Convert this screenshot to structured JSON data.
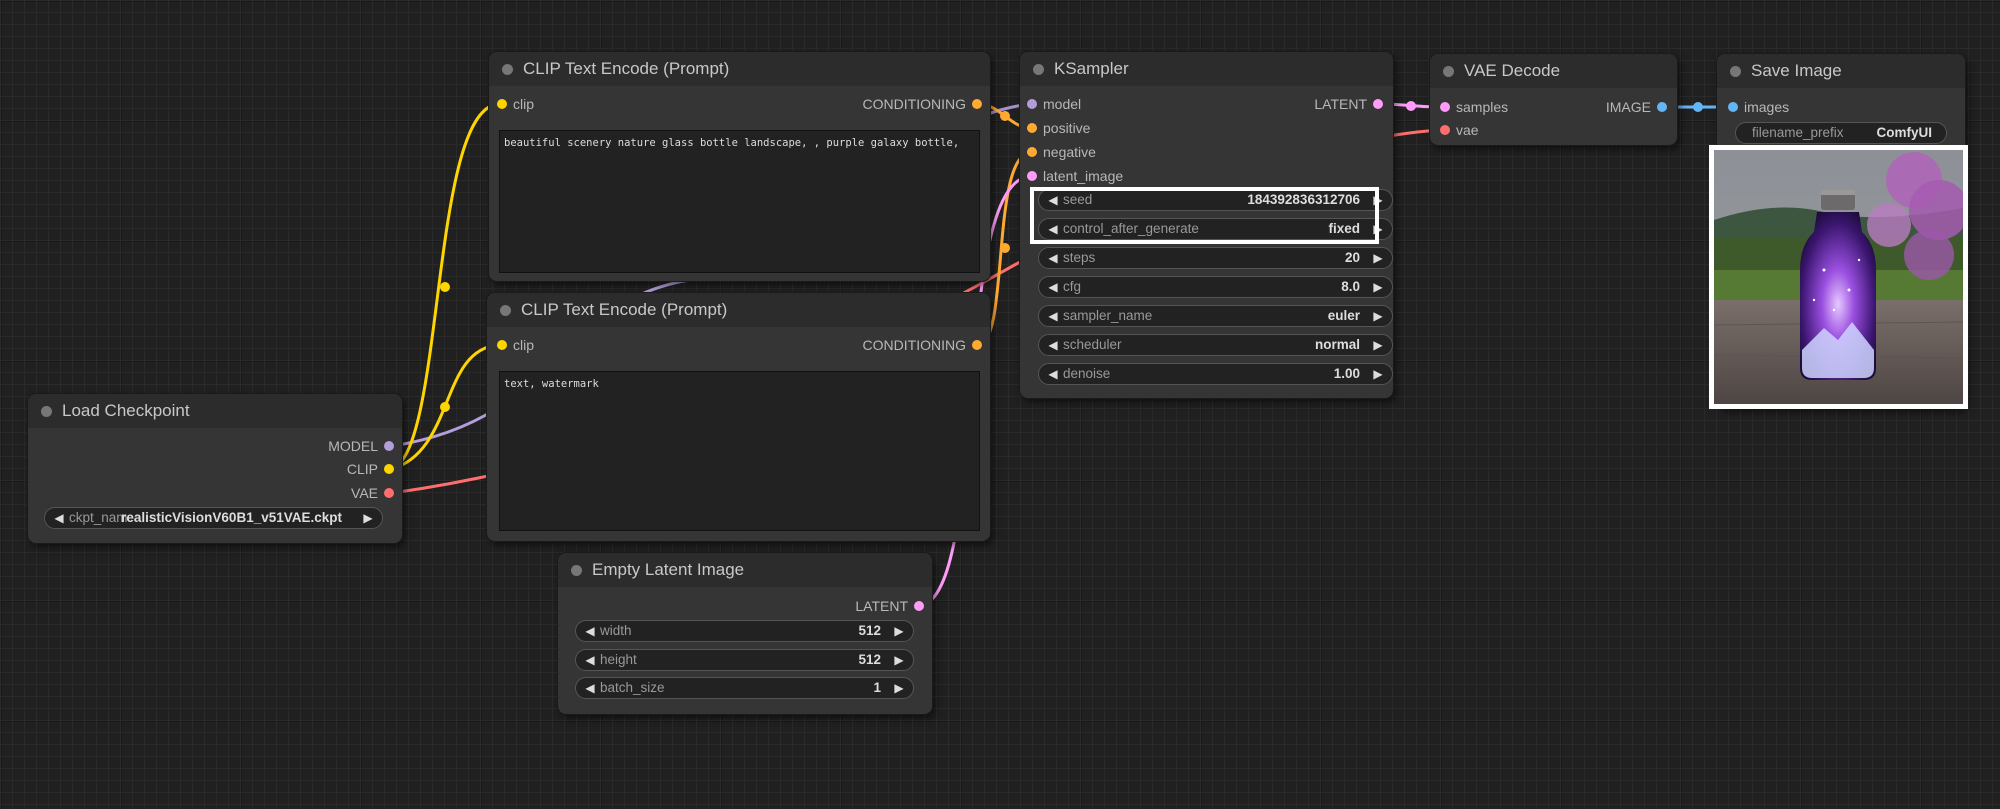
{
  "nodes": {
    "clip1": {
      "title": "CLIP Text Encode (Prompt)",
      "input_clip": "clip",
      "output": "CONDITIONING",
      "text": "beautiful scenery nature glass bottle landscape, , purple galaxy bottle,"
    },
    "clip2": {
      "title": "CLIP Text Encode (Prompt)",
      "input_clip": "clip",
      "output": "CONDITIONING",
      "text": "text, watermark"
    },
    "ksampler": {
      "title": "KSampler",
      "inputs": [
        "model",
        "positive",
        "negative",
        "latent_image"
      ],
      "output": "LATENT",
      "widgets": [
        {
          "label": "seed",
          "value": "184392836312706"
        },
        {
          "label": "control_after_generate",
          "value": "fixed"
        },
        {
          "label": "steps",
          "value": "20"
        },
        {
          "label": "cfg",
          "value": "8.0"
        },
        {
          "label": "sampler_name",
          "value": "euler"
        },
        {
          "label": "scheduler",
          "value": "normal"
        },
        {
          "label": "denoise",
          "value": "1.00"
        }
      ]
    },
    "vae_decode": {
      "title": "VAE Decode",
      "inputs": [
        "samples",
        "vae"
      ],
      "output": "IMAGE"
    },
    "save_image": {
      "title": "Save Image",
      "input": "images",
      "filename_label": "filename_prefix",
      "filename_value": "ComfyUI"
    },
    "load_checkpoint": {
      "title": "Load Checkpoint",
      "outputs": [
        "MODEL",
        "CLIP",
        "VAE"
      ],
      "ckpt_label": "ckpt_nam",
      "ckpt_value": "realisticVisionV60B1_v51VAE.ckpt"
    },
    "empty_latent": {
      "title": "Empty Latent Image",
      "output": "LATENT",
      "widgets": [
        {
          "label": "width",
          "value": "512"
        },
        {
          "label": "height",
          "value": "512"
        },
        {
          "label": "batch_size",
          "value": "1"
        }
      ]
    }
  },
  "colors": {
    "clip": "#ffd500",
    "model": "#b39ddb",
    "conditioning": "#ffa931",
    "latent": "#ff9cf9",
    "vae": "#ff6e6e",
    "image": "#64b5f6"
  },
  "icons": {
    "arrow_left": "◀",
    "arrow_right": "▶"
  }
}
